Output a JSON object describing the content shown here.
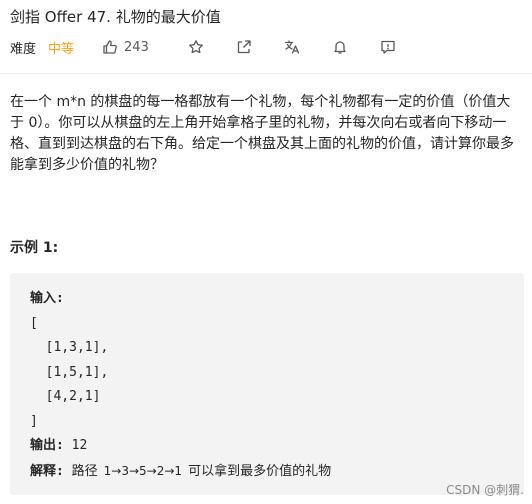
{
  "header": {
    "title": "剑指 Offer 47. 礼物的最大价值"
  },
  "meta": {
    "difficulty_label": "难度",
    "difficulty_value": "中等",
    "like_count": "243",
    "accent_color": "#ffa116"
  },
  "description": "在一个 m*n 的棋盘的每一格都放有一个礼物，每个礼物都有一定的价值（价值大于 0）。你可以从棋盘的左上角开始拿格子里的礼物，并每次向右或者向下移动一格、直到到达棋盘的右下角。给定一个棋盘及其上面的礼物的价值，请计算你最多能拿到多少价值的礼物？",
  "example": {
    "title": "示例 1:",
    "input_label": "输入:",
    "input_lines": [
      "[",
      "  [1,3,1],",
      "  [1,5,1],",
      "  [4,2,1]",
      "]"
    ],
    "output_label": "输出:",
    "output_value": "12",
    "explain_label": "解释:",
    "explain_prefix": "路径",
    "explain_path": "1→3→5→2→1",
    "explain_suffix": "可以拿到最多价值的礼物"
  },
  "watermark": "CSDN @刺猬."
}
